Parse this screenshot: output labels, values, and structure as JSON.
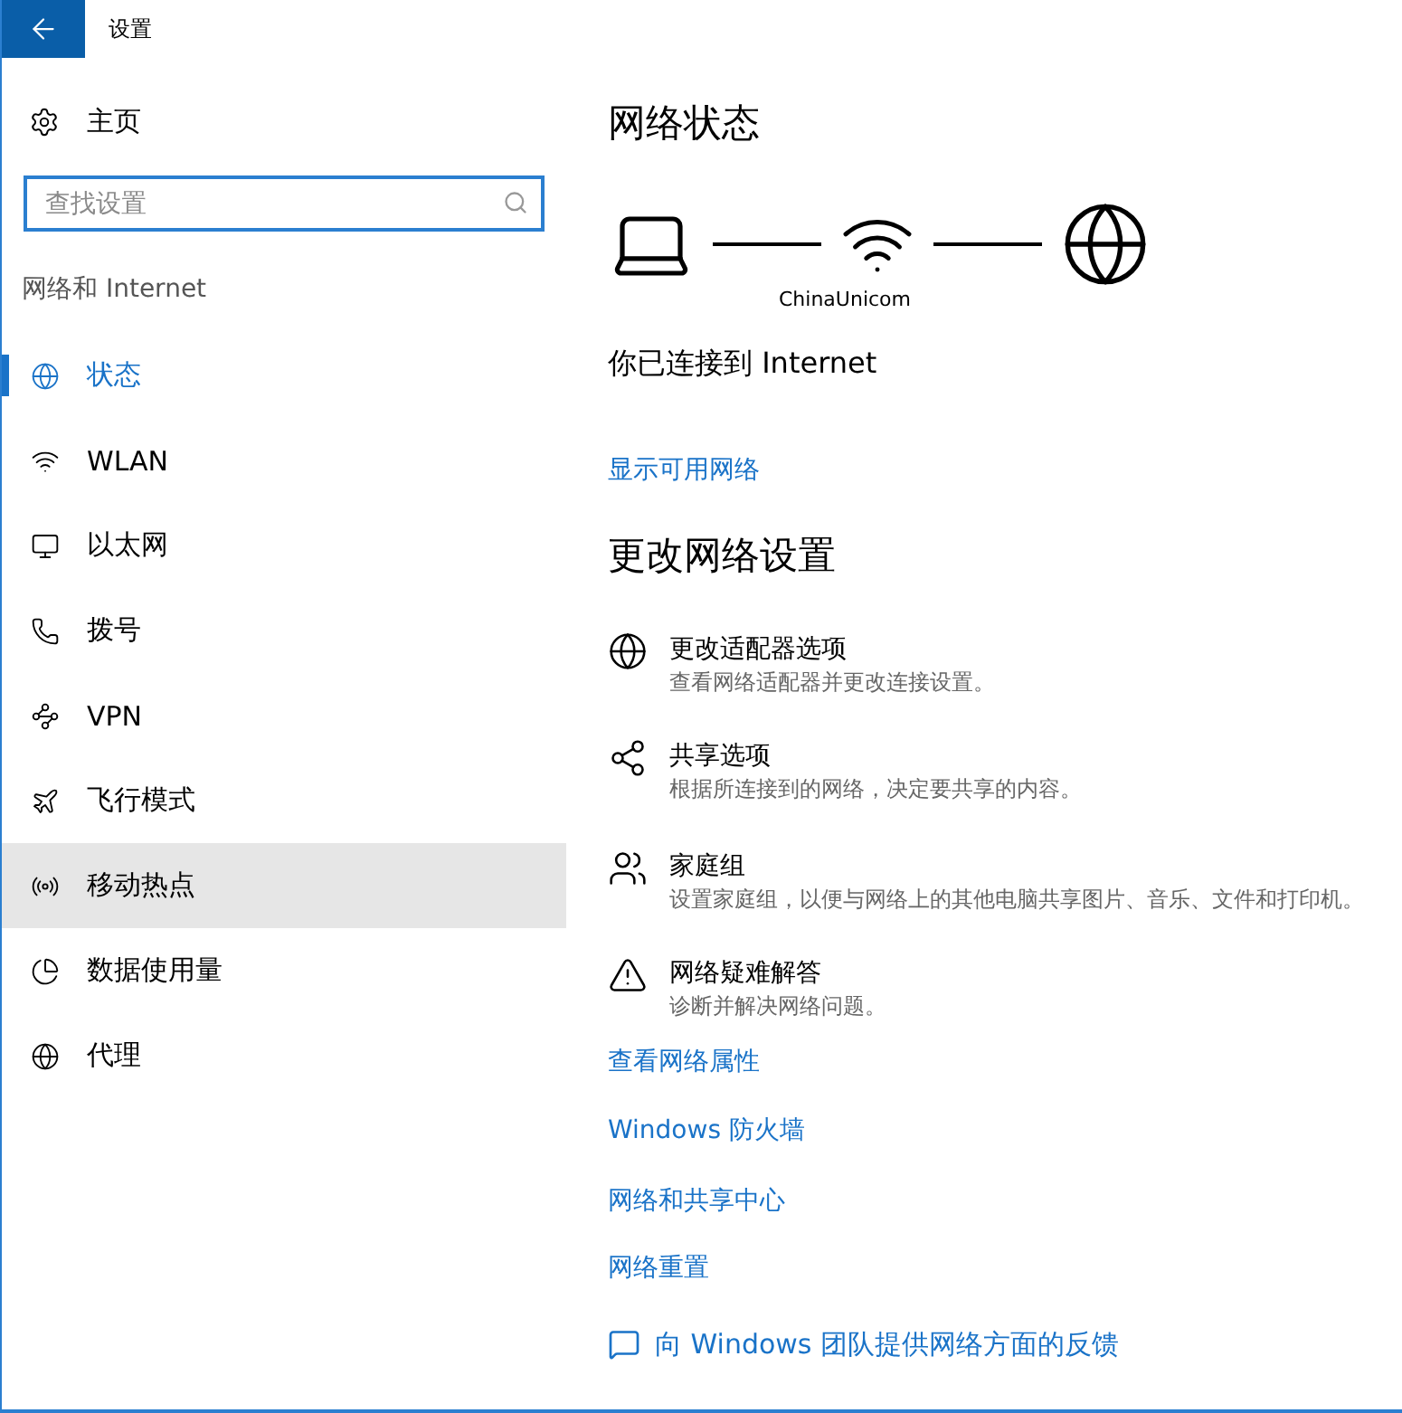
{
  "window": {
    "title": "设置"
  },
  "sidebar": {
    "home": "主页",
    "search": {
      "placeholder": "查找设置"
    },
    "section": "网络和 Internet",
    "items": [
      {
        "label": "状态",
        "selected": true,
        "hovered": false
      },
      {
        "label": "WLAN",
        "selected": false,
        "hovered": false
      },
      {
        "label": "以太网",
        "selected": false,
        "hovered": false
      },
      {
        "label": "拨号",
        "selected": false,
        "hovered": false
      },
      {
        "label": "VPN",
        "selected": false,
        "hovered": false
      },
      {
        "label": "飞行模式",
        "selected": false,
        "hovered": false
      },
      {
        "label": "移动热点",
        "selected": false,
        "hovered": true
      },
      {
        "label": "数据使用量",
        "selected": false,
        "hovered": false
      },
      {
        "label": "代理",
        "selected": false,
        "hovered": false
      }
    ]
  },
  "main": {
    "title": "网络状态",
    "network_name": "ChinaUnicom",
    "status": "你已连接到 Internet",
    "show_networks_link": "显示可用网络",
    "settings_title": "更改网络设置",
    "options": [
      {
        "title": "更改适配器选项",
        "description": "查看网络适配器并更改连接设置。"
      },
      {
        "title": "共享选项",
        "description": "根据所连接到的网络，决定要共享的内容。"
      },
      {
        "title": "家庭组",
        "description": "设置家庭组，以便与网络上的其他电脑共享图片、音乐、文件和打印机。"
      },
      {
        "title": "网络疑难解答",
        "description": "诊断并解决网络问题。"
      }
    ],
    "links": [
      "查看网络属性",
      "Windows 防火墙",
      "网络和共享中心",
      "网络重置"
    ],
    "feedback": "向 Windows 团队提供网络方面的反馈"
  }
}
